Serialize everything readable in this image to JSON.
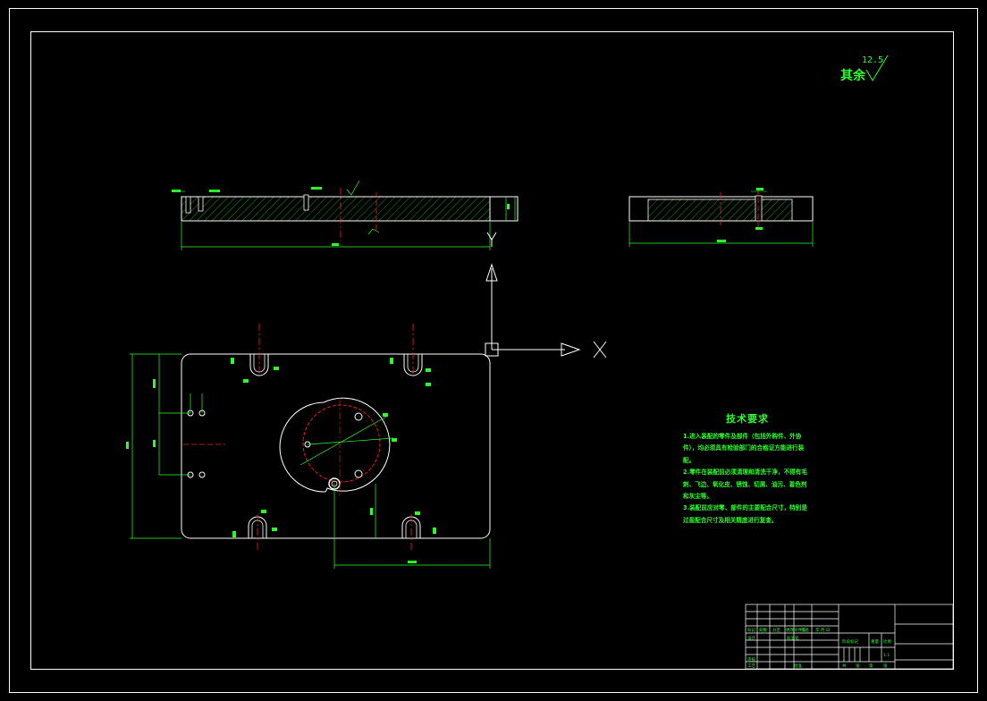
{
  "drawing": {
    "roughness": {
      "prefix": "其余",
      "value": "12.5"
    },
    "tech_requirements": {
      "title": "技术要求",
      "items": [
        "1.进入装配的零件及部件（包括外购件、外协件），均必须具有检验部门的合格证方能进行装配。",
        "2.零件在装配前必须清理和清洗干净，不得有毛刺、飞边、氧化皮、锈蚀、切屑、油污、着色剂和灰尘等。",
        "3.装配前应对零、部件的主要配合尺寸，特别是过盈配合尺寸及相关精度进行复查。"
      ]
    },
    "axes": {
      "x_label": "X",
      "y_label": "Y"
    },
    "title_block": {
      "scale": "1:1",
      "labels": [
        "标记",
        "处数",
        "分区",
        "更改文件号",
        "签名",
        "年.月.日",
        "设计",
        "标准化",
        "阶段标记",
        "重量",
        "比例",
        "审核",
        "工艺",
        "批准",
        "共",
        "张",
        "第",
        "张"
      ]
    }
  }
}
